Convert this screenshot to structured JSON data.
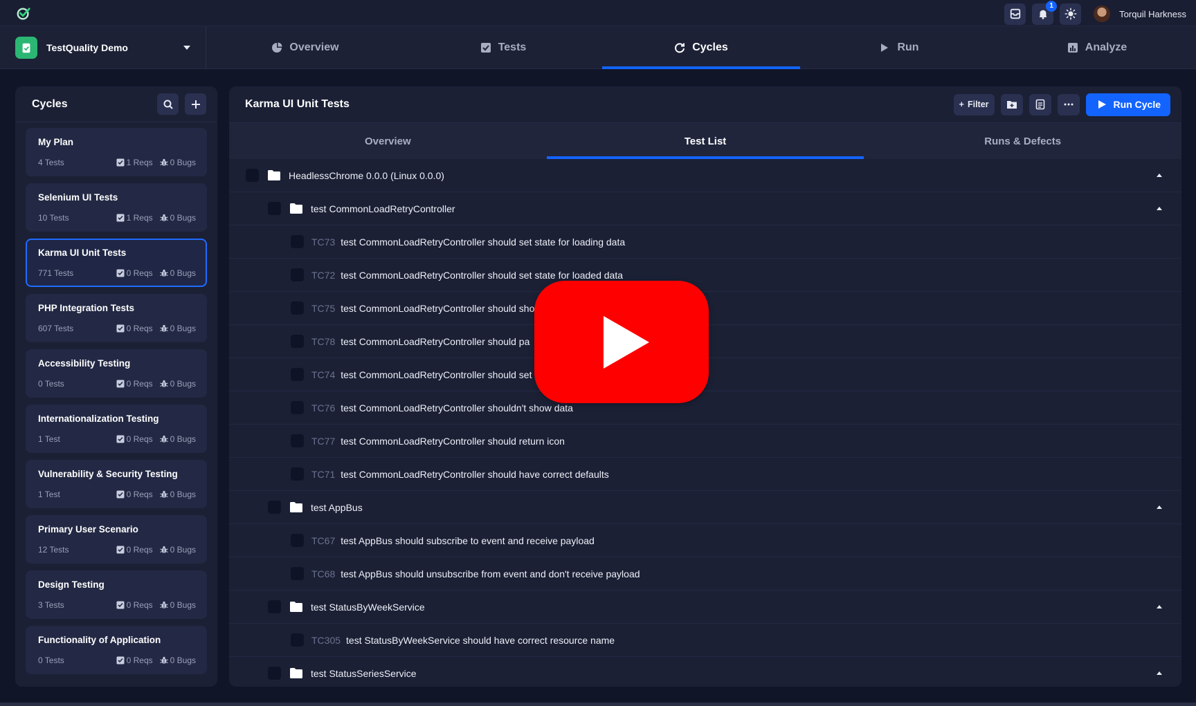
{
  "topbar": {
    "logo_icon": "check-circle-logo-icon",
    "notification_count": "1",
    "user_name": "Torquil Harkness"
  },
  "project": {
    "name": "TestQuality Demo"
  },
  "nav": {
    "tabs": [
      {
        "label": "Overview",
        "icon": "pie-chart-icon"
      },
      {
        "label": "Tests",
        "icon": "checkbox-icon"
      },
      {
        "label": "Cycles",
        "icon": "refresh-icon",
        "active": true
      },
      {
        "label": "Run",
        "icon": "play-icon"
      },
      {
        "label": "Analyze",
        "icon": "bar-chart-icon"
      }
    ]
  },
  "sidebar": {
    "title": "Cycles",
    "cycles": [
      {
        "name": "My Plan",
        "tests": "4 Tests",
        "reqs": "1 Reqs",
        "bugs": "0 Bugs"
      },
      {
        "name": "Selenium UI Tests",
        "tests": "10 Tests",
        "reqs": "1 Reqs",
        "bugs": "0 Bugs"
      },
      {
        "name": "Karma UI Unit Tests",
        "tests": "771 Tests",
        "reqs": "0 Reqs",
        "bugs": "0 Bugs",
        "active": true
      },
      {
        "name": "PHP Integration Tests",
        "tests": "607 Tests",
        "reqs": "0 Reqs",
        "bugs": "0 Bugs"
      },
      {
        "name": "Accessibility Testing",
        "tests": "0 Tests",
        "reqs": "0 Reqs",
        "bugs": "0 Bugs"
      },
      {
        "name": "Internationalization Testing",
        "tests": "1 Test",
        "reqs": "0 Reqs",
        "bugs": "0 Bugs"
      },
      {
        "name": "Vulnerability & Security Testing",
        "tests": "1 Test",
        "reqs": "0 Reqs",
        "bugs": "0 Bugs"
      },
      {
        "name": "Primary User Scenario",
        "tests": "12 Tests",
        "reqs": "0 Reqs",
        "bugs": "0 Bugs"
      },
      {
        "name": "Design Testing",
        "tests": "3 Tests",
        "reqs": "0 Reqs",
        "bugs": "0 Bugs"
      },
      {
        "name": "Functionality of Application",
        "tests": "0 Tests",
        "reqs": "0 Reqs",
        "bugs": "0 Bugs"
      }
    ]
  },
  "main": {
    "title": "Karma UI Unit Tests",
    "filter_label": "Filter",
    "run_label": "Run Cycle",
    "subtabs": [
      {
        "label": "Overview"
      },
      {
        "label": "Test List",
        "active": true
      },
      {
        "label": "Runs & Defects"
      }
    ],
    "tree": [
      {
        "type": "folder",
        "level": 0,
        "label": "HeadlessChrome 0.0.0 (Linux 0.0.0)"
      },
      {
        "type": "folder",
        "level": 1,
        "label": "test CommonLoadRetryController"
      },
      {
        "type": "test",
        "key": "TC73",
        "label": "test CommonLoadRetryController should set state for loading data"
      },
      {
        "type": "test",
        "key": "TC72",
        "label": "test CommonLoadRetryController should set state for loaded data"
      },
      {
        "type": "test",
        "key": "TC75",
        "label": "test CommonLoadRetryController should sho"
      },
      {
        "type": "test",
        "key": "TC78",
        "label": "test CommonLoadRetryController should pa"
      },
      {
        "type": "test",
        "key": "TC74",
        "label": "test CommonLoadRetryController should set"
      },
      {
        "type": "test",
        "key": "TC76",
        "label": "test CommonLoadRetryController shouldn't show data"
      },
      {
        "type": "test",
        "key": "TC77",
        "label": "test CommonLoadRetryController should return icon"
      },
      {
        "type": "test",
        "key": "TC71",
        "label": "test CommonLoadRetryController should have correct defaults"
      },
      {
        "type": "folder",
        "level": 1,
        "label": "test AppBus"
      },
      {
        "type": "test",
        "key": "TC67",
        "label": "test AppBus should subscribe to event and receive payload"
      },
      {
        "type": "test",
        "key": "TC68",
        "label": "test AppBus should unsubscribe from event and don't receive payload"
      },
      {
        "type": "folder",
        "level": 1,
        "label": "test StatusByWeekService"
      },
      {
        "type": "test",
        "key": "TC305",
        "label": "test StatusByWeekService should have correct resource name"
      },
      {
        "type": "folder",
        "level": 1,
        "label": "test StatusSeriesService"
      }
    ]
  },
  "overlay": {
    "icon": "youtube-play-icon",
    "color": "#ff0000"
  },
  "colors": {
    "accent": "#1363ff",
    "background": "#111528",
    "panel": "#1b2035"
  }
}
